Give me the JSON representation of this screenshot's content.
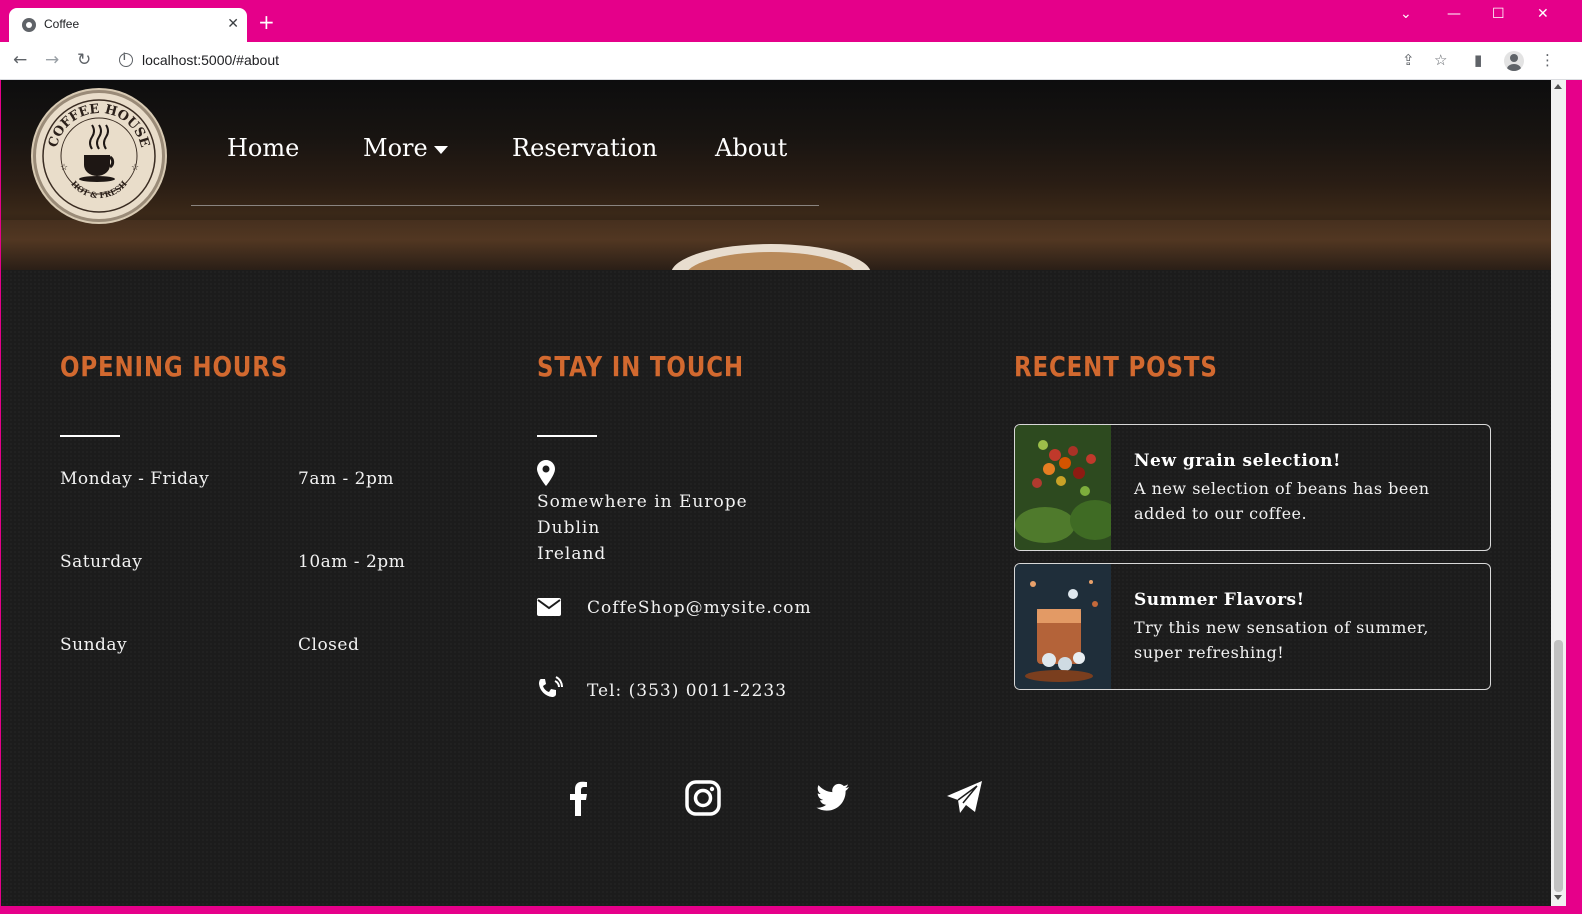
{
  "browser": {
    "tab_title": "Coffee",
    "url": "localhost:5000/#about",
    "new_tab": "+",
    "close_tab": "✕",
    "chrome_color": "#e5008a"
  },
  "logo": {
    "top_text": "COFFEE HOUSE",
    "bottom_text": "HOT & FRESH"
  },
  "nav": {
    "home": "Home",
    "more": "More",
    "reservation": "Reservation",
    "about": "About"
  },
  "opening_hours": {
    "heading": "OPENING HOURS",
    "rows": [
      {
        "day": "Monday - Friday",
        "time": "7am - 2pm"
      },
      {
        "day": "Saturday",
        "time": "10am - 2pm"
      },
      {
        "day": "Sunday",
        "time": "Closed"
      }
    ]
  },
  "contact": {
    "heading": "STAY IN TOUCH",
    "address_line1": "Somewhere in Europe",
    "address_line2": "Dublin",
    "address_line3": "Ireland",
    "email": "CoffeShop@mysite.com",
    "phone": "Tel: (353) 0011-2233",
    "icons": [
      "map-pin-icon",
      "envelope-icon",
      "phone-icon"
    ]
  },
  "recent_posts": {
    "heading": "RECENT POSTS",
    "posts": [
      {
        "title": "New grain selection!",
        "text": "A new selection of beans has been added to our coffee."
      },
      {
        "title": "Summer Flavors!",
        "text": "Try this new sensation of summer, super refreshing!"
      }
    ]
  },
  "social": [
    "facebook-icon",
    "instagram-icon",
    "twitter-icon",
    "telegram-icon"
  ],
  "colors": {
    "accent": "#d2692f",
    "background": "#1c1c1c",
    "text": "#f2f2f2"
  }
}
